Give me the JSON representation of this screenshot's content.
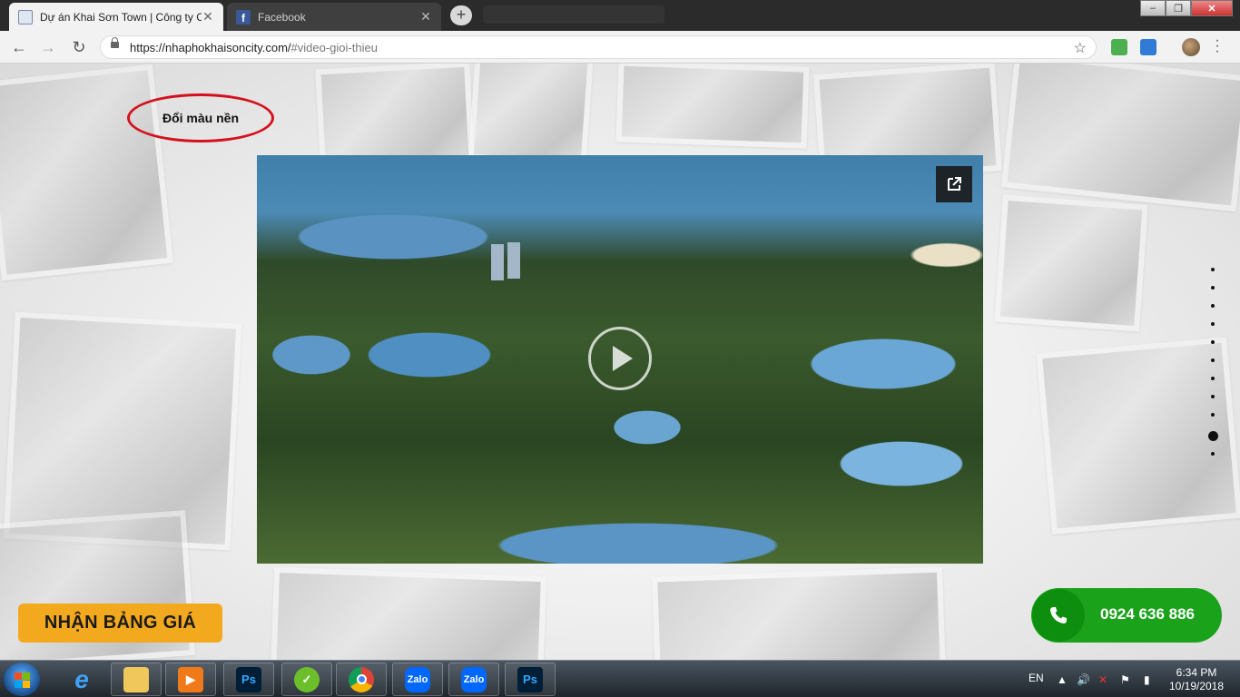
{
  "browser": {
    "tabs": [
      {
        "title": "Dự án Khai Sơn Town | Công ty C",
        "active": true
      },
      {
        "title": "Facebook",
        "active": false
      }
    ],
    "url_host": "https://nhaphokhaisoncity.com/",
    "url_path": "#video-gioi-thieu"
  },
  "page": {
    "change_background_label": "Đổi màu nền",
    "price_button_label": "NHẬN BẢNG GIÁ",
    "hotline_number": "0924 636 886",
    "section_dots_count": 11,
    "section_dots_active_index": 9
  },
  "taskbar": {
    "apps": [
      "Internet Explorer",
      "File Explorer",
      "Media Player",
      "Photoshop",
      "Coc Coc",
      "Chrome",
      "Zalo",
      "Zalo",
      "Photoshop"
    ],
    "language": "EN",
    "time": "6:34 PM",
    "date": "10/19/2018"
  },
  "colors": {
    "accent_orange": "#f3a91e",
    "hotline_green": "#1aa31a",
    "highlight_red": "#d4121d"
  }
}
